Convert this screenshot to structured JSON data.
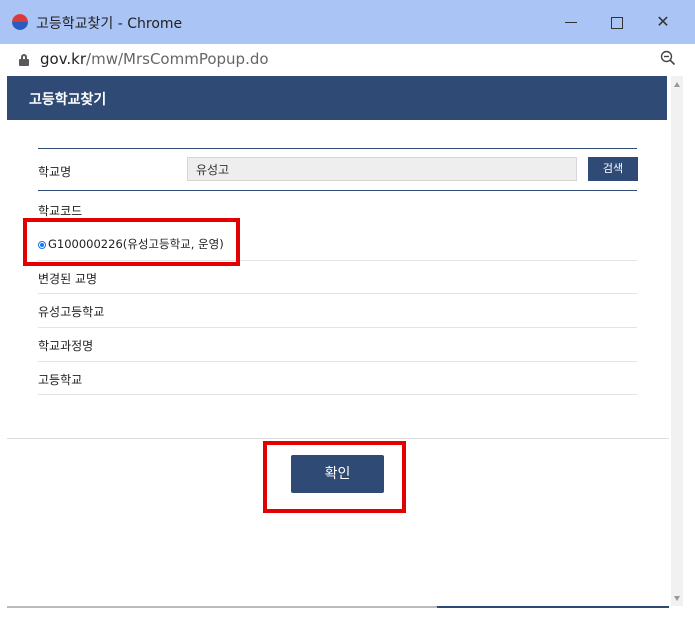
{
  "window": {
    "title": "고등학교찾기 - Chrome",
    "minimize": "",
    "maximize": "",
    "close": "✕"
  },
  "address": {
    "domain": "gov.kr",
    "path": "/mw/MrsCommPopup.do"
  },
  "page": {
    "header": "고등학교찾기",
    "school_name_label": "학교명",
    "search_value": "유성고",
    "search_button": "검색",
    "school_code_label": "학교코드",
    "result_option": "G100000226(유성고등학교, 운영)",
    "changed_name_label": "변경된 교명",
    "changed_name_value": "유성고등학교",
    "course_label": "학교과정명",
    "course_value": "고등학교",
    "confirm_button": "확인"
  },
  "colors": {
    "titlebar": "#a9c4f5",
    "header": "#2e4a75",
    "highlight": "#e30000"
  }
}
